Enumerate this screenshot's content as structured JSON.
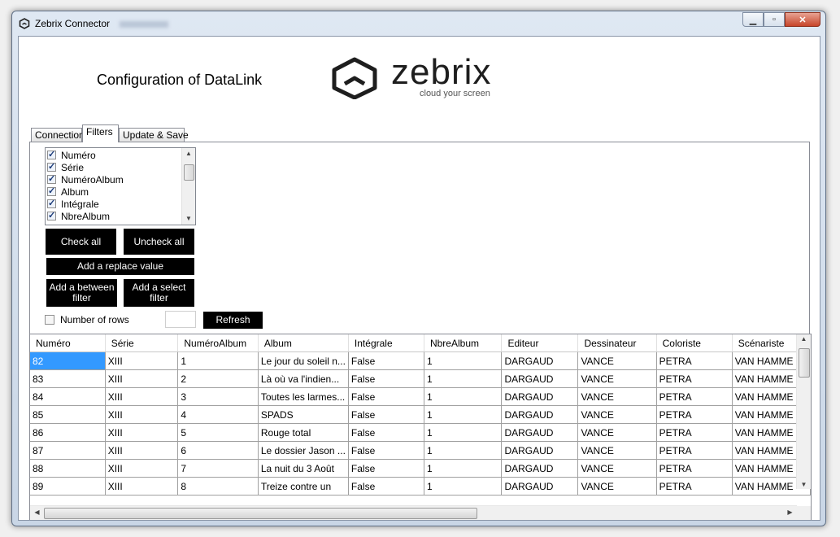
{
  "window": {
    "title": "Zebrix Connector"
  },
  "header": {
    "title": "Configuration of DataLink",
    "logo_word": "zebrix",
    "logo_tagline": "cloud your screen"
  },
  "tabs": [
    {
      "label": "Connection",
      "active": false
    },
    {
      "label": "Filters",
      "active": true
    },
    {
      "label": "Update & Save",
      "active": false
    }
  ],
  "filters": {
    "columns": [
      {
        "label": "Numéro",
        "checked": true
      },
      {
        "label": "Série",
        "checked": true
      },
      {
        "label": "NuméroAlbum",
        "checked": true
      },
      {
        "label": "Album",
        "checked": true
      },
      {
        "label": "Intégrale",
        "checked": true
      },
      {
        "label": "NbreAlbum",
        "checked": true
      }
    ],
    "check_all": "Check all",
    "uncheck_all": "Uncheck all",
    "add_replace": "Add a replace value",
    "add_between_line1": "Add a between",
    "add_between_line2": "filter",
    "add_select_line1": "Add a select",
    "add_select_line2": "filter",
    "number_of_rows_label": "Number of rows",
    "number_of_rows_checked": false,
    "number_of_rows_value": "",
    "refresh": "Refresh"
  },
  "grid": {
    "headers": [
      "Numéro",
      "Série",
      "NuméroAlbum",
      "Album",
      "Intégrale",
      "NbreAlbum",
      "Editeur",
      "Dessinateur",
      "Coloriste",
      "Scénariste"
    ],
    "rows": [
      [
        "82",
        "XIII",
        "1",
        "Le jour du soleil n...",
        "False",
        "1",
        "DARGAUD",
        "VANCE",
        "PETRA",
        "VAN HAMME"
      ],
      [
        "83",
        "XIII",
        "2",
        "Là où va l'indien...",
        "False",
        "1",
        "DARGAUD",
        "VANCE",
        "PETRA",
        "VAN HAMME"
      ],
      [
        "84",
        "XIII",
        "3",
        "Toutes les larmes...",
        "False",
        "1",
        "DARGAUD",
        "VANCE",
        "PETRA",
        "VAN HAMME"
      ],
      [
        "85",
        "XIII",
        "4",
        "SPADS",
        "False",
        "1",
        "DARGAUD",
        "VANCE",
        "PETRA",
        "VAN HAMME"
      ],
      [
        "86",
        "XIII",
        "5",
        "Rouge total",
        "False",
        "1",
        "DARGAUD",
        "VANCE",
        "PETRA",
        "VAN HAMME"
      ],
      [
        "87",
        "XIII",
        "6",
        "Le dossier Jason ...",
        "False",
        "1",
        "DARGAUD",
        "VANCE",
        "PETRA",
        "VAN HAMME"
      ],
      [
        "88",
        "XIII",
        "7",
        "La nuit du 3 Août",
        "False",
        "1",
        "DARGAUD",
        "VANCE",
        "PETRA",
        "VAN HAMME"
      ],
      [
        "89",
        "XIII",
        "8",
        "Treize contre un",
        "False",
        "1",
        "DARGAUD",
        "VANCE",
        "PETRA",
        "VAN HAMME"
      ]
    ],
    "selected_row": 0
  },
  "colors": {
    "selection": "#3399ff",
    "button_bg": "#000000",
    "button_fg": "#ffffff"
  }
}
